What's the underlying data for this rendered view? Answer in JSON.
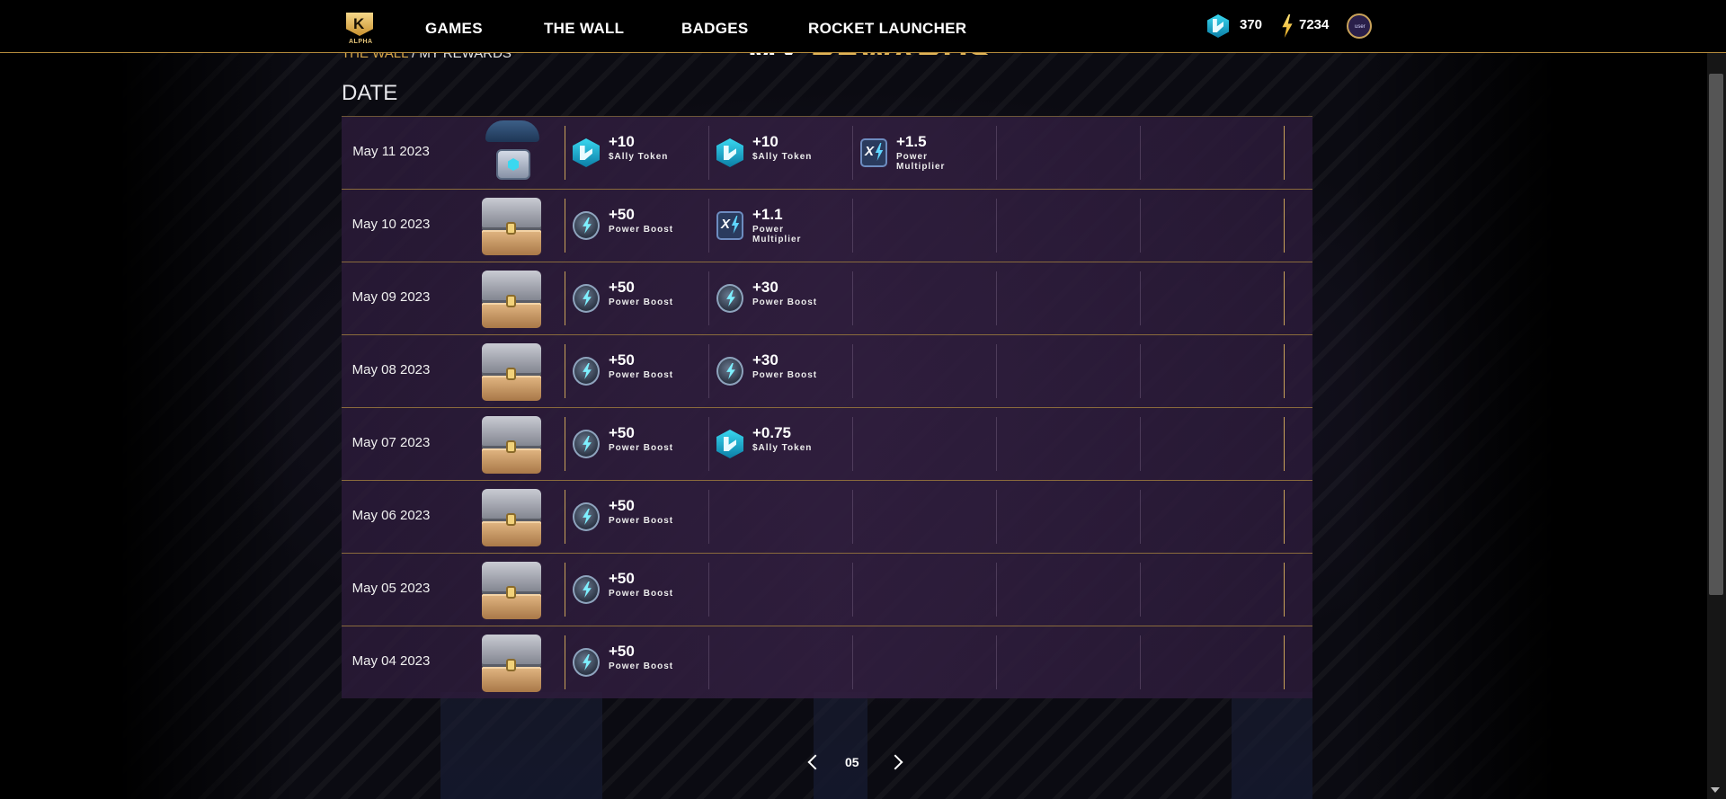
{
  "header": {
    "logo_text": "ALPHA",
    "nav": [
      "GAMES",
      "THE WALL",
      "BADGES",
      "ROCKET LAUNCHER"
    ],
    "ally_balance": "370",
    "power_balance": "7234",
    "avatar_text": "user"
  },
  "breadcrumb": {
    "parent": "THE WALL",
    "separator": "/",
    "current": "MY REWARDS"
  },
  "page_title": {
    "first": "MY ",
    "second": "REWARDS"
  },
  "date_header": "DATE",
  "rows": [
    {
      "date": "May 11 2023",
      "box": "airdrop",
      "rewards": [
        {
          "icon": "ally-token-icon",
          "value": "+10",
          "label": "$Ally Token"
        },
        {
          "icon": "ally-token-icon",
          "value": "+10",
          "label": "$Ally Token"
        },
        {
          "icon": "power-multiplier-icon",
          "value": "+1.5",
          "label": "Power Multiplier"
        }
      ]
    },
    {
      "date": "May 10 2023",
      "box": "chest",
      "rewards": [
        {
          "icon": "power-boost-icon",
          "value": "+50",
          "label": "Power Boost"
        },
        {
          "icon": "power-multiplier-icon",
          "value": "+1.1",
          "label": "Power Multiplier"
        }
      ]
    },
    {
      "date": "May 09 2023",
      "box": "chest",
      "rewards": [
        {
          "icon": "power-boost-icon",
          "value": "+50",
          "label": "Power Boost"
        },
        {
          "icon": "power-boost-icon",
          "value": "+30",
          "label": "Power Boost"
        }
      ]
    },
    {
      "date": "May 08 2023",
      "box": "chest",
      "rewards": [
        {
          "icon": "power-boost-icon",
          "value": "+50",
          "label": "Power Boost"
        },
        {
          "icon": "power-boost-icon",
          "value": "+30",
          "label": "Power Boost"
        }
      ]
    },
    {
      "date": "May 07 2023",
      "box": "chest",
      "rewards": [
        {
          "icon": "power-boost-icon",
          "value": "+50",
          "label": "Power Boost"
        },
        {
          "icon": "ally-token-icon",
          "value": "+0.75",
          "label": "$Ally Token"
        }
      ]
    },
    {
      "date": "May 06 2023",
      "box": "chest",
      "rewards": [
        {
          "icon": "power-boost-icon",
          "value": "+50",
          "label": "Power Boost"
        }
      ]
    },
    {
      "date": "May 05 2023",
      "box": "chest",
      "rewards": [
        {
          "icon": "power-boost-icon",
          "value": "+50",
          "label": "Power Boost"
        }
      ]
    },
    {
      "date": "May 04 2023",
      "box": "chest",
      "rewards": [
        {
          "icon": "power-boost-icon",
          "value": "+50",
          "label": "Power Boost"
        }
      ]
    }
  ],
  "pagination": {
    "page": "05"
  },
  "colors": {
    "accent_gold": "#d6a64b",
    "row_bg": "#2c1c3a",
    "ally_cyan": "#3ad8f0"
  }
}
